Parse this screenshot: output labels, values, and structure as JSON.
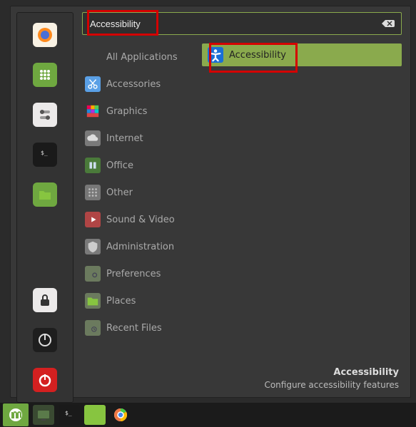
{
  "search": {
    "value": "Accessibility"
  },
  "favorites": [
    {
      "name": "firefox",
      "bg": "#f9f2e4",
      "svg": "firefox"
    },
    {
      "name": "apps",
      "bg": "#6fa840",
      "svg": "grid"
    },
    {
      "name": "settings-toggles",
      "bg": "#eceaea",
      "svg": "toggles"
    },
    {
      "name": "terminal",
      "bg": "#1a1a1a",
      "svg": "terminal"
    },
    {
      "name": "files",
      "bg": "#6fa840",
      "svg": "folder"
    }
  ],
  "favorites_bottom": [
    {
      "name": "lock",
      "bg": "#eceaea",
      "svg": "lock"
    },
    {
      "name": "logout",
      "bg": "#1e1e1e",
      "svg": "logout"
    },
    {
      "name": "power",
      "bg": "#d42020",
      "svg": "power"
    }
  ],
  "categories": [
    {
      "label": "All Applications",
      "icon": "none",
      "color": ""
    },
    {
      "label": "Accessories",
      "icon": "scissors",
      "color": "#5aa0e6"
    },
    {
      "label": "Graphics",
      "icon": "rainbow",
      "color": ""
    },
    {
      "label": "Internet",
      "icon": "cloud",
      "color": "#7a7a7a"
    },
    {
      "label": "Office",
      "icon": "office",
      "color": "#4a7a3a"
    },
    {
      "label": "Other",
      "icon": "dots",
      "color": "#777"
    },
    {
      "label": "Sound & Video",
      "icon": "play",
      "color": "#b04545"
    },
    {
      "label": "Administration",
      "icon": "shield",
      "color": "#7a7a7a"
    },
    {
      "label": "Preferences",
      "icon": "gear-folder",
      "color": "#6b7a5e"
    },
    {
      "label": "Places",
      "icon": "folder",
      "color": "#6b7a5e"
    },
    {
      "label": "Recent Files",
      "icon": "recent",
      "color": "#6b7a5e"
    }
  ],
  "result": {
    "label": "Accessibility"
  },
  "footer": {
    "title": "Accessibility",
    "desc": "Configure accessibility features"
  },
  "taskbar": [
    {
      "name": "mint-menu",
      "svg": "mint"
    },
    {
      "name": "show-desktop",
      "svg": "desktop"
    },
    {
      "name": "terminal",
      "svg": "terminal"
    },
    {
      "name": "files",
      "svg": "folder"
    },
    {
      "name": "chrome",
      "svg": "chrome"
    }
  ]
}
